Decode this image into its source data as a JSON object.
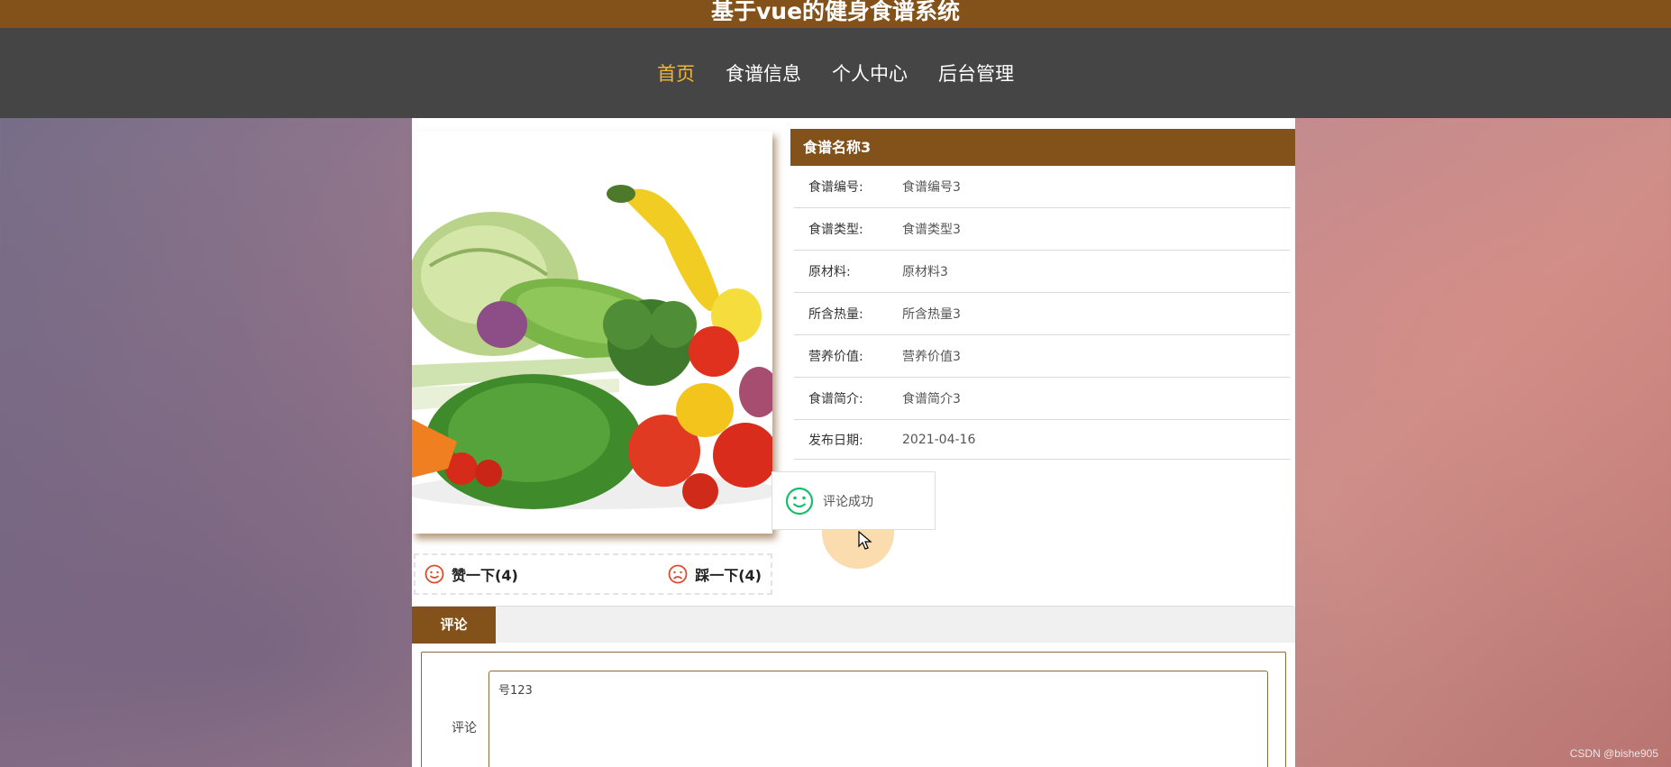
{
  "header": {
    "title": "基于vue的健身食谱系统"
  },
  "nav": {
    "items": [
      {
        "label": "首页",
        "active": true
      },
      {
        "label": "食谱信息",
        "active": false
      },
      {
        "label": "个人中心",
        "active": false
      },
      {
        "label": "后台管理",
        "active": false
      }
    ]
  },
  "detail": {
    "title": "食谱名称3",
    "rows": [
      {
        "label": "食谱编号:",
        "value": "食谱编号3"
      },
      {
        "label": "食谱类型:",
        "value": "食谱类型3"
      },
      {
        "label": "原材料:",
        "value": "原材料3"
      },
      {
        "label": "所含热量:",
        "value": "所含热量3"
      },
      {
        "label": "营养价值:",
        "value": "营养价值3"
      },
      {
        "label": "食谱简介:",
        "value": "食谱简介3"
      },
      {
        "label": "发布日期:",
        "value": "2021-04-16"
      }
    ]
  },
  "votes": {
    "like_label": "赞一下(4)",
    "dislike_label": "踩一下(4)"
  },
  "toast": {
    "message": "评论成功"
  },
  "tabs": {
    "comment_label": "评论"
  },
  "comment": {
    "label": "评论",
    "value": "号123"
  },
  "watermark": "CSDN @bishe905",
  "colors": {
    "brand": "#83521a",
    "nav_bg": "#454545",
    "nav_active": "#f1b535",
    "success": "#19be6b"
  }
}
